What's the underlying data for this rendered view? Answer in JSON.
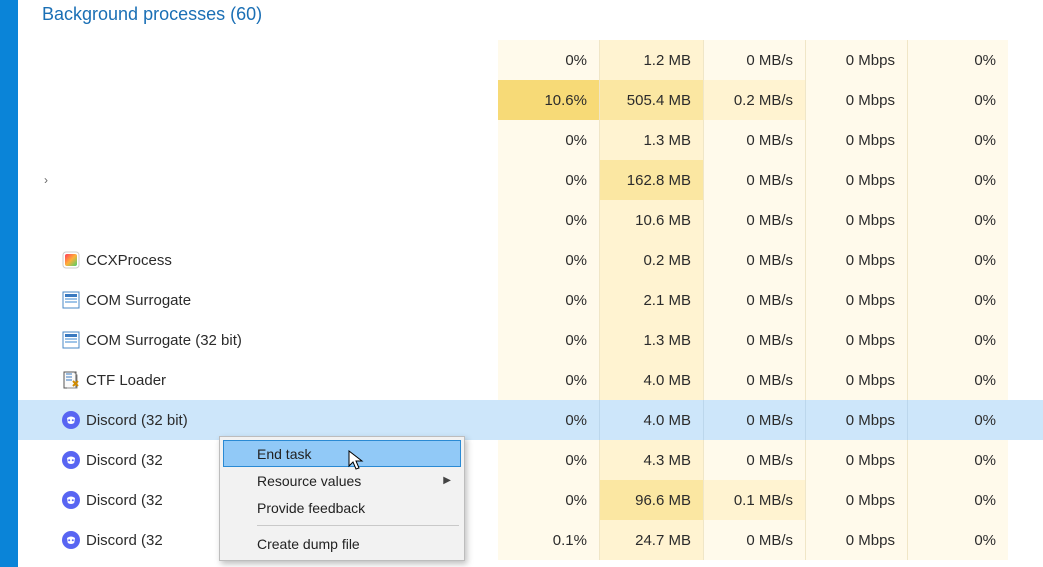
{
  "section_title": "Background processes (60)",
  "rows": [
    {
      "name": "",
      "icon": "",
      "caret": "",
      "cpu": "0%",
      "mem": "1.2 MB",
      "disk": "0 MB/s",
      "net": "0 Mbps",
      "gpu": "0%",
      "heat_cpu": "heat0",
      "heat_mem": "heat1",
      "heat_disk": "heat0",
      "heat_net": "heat0",
      "heat_gpu": "heat0",
      "selected": false
    },
    {
      "name": "",
      "icon": "",
      "caret": "",
      "cpu": "10.6%",
      "mem": "505.4 MB",
      "disk": "0.2 MB/s",
      "net": "0 Mbps",
      "gpu": "0%",
      "heat_cpu": "heat3",
      "heat_mem": "heat2",
      "heat_disk": "heat1",
      "heat_net": "heat0",
      "heat_gpu": "heat0",
      "selected": false
    },
    {
      "name": "",
      "icon": "",
      "caret": "",
      "cpu": "0%",
      "mem": "1.3 MB",
      "disk": "0 MB/s",
      "net": "0 Mbps",
      "gpu": "0%",
      "heat_cpu": "heat0",
      "heat_mem": "heat1",
      "heat_disk": "heat0",
      "heat_net": "heat0",
      "heat_gpu": "heat0",
      "selected": false
    },
    {
      "name": "",
      "icon": "",
      "caret": ">",
      "cpu": "0%",
      "mem": "162.8 MB",
      "disk": "0 MB/s",
      "net": "0 Mbps",
      "gpu": "0%",
      "heat_cpu": "heat0",
      "heat_mem": "heat2",
      "heat_disk": "heat0",
      "heat_net": "heat0",
      "heat_gpu": "heat0",
      "selected": false
    },
    {
      "name": "",
      "icon": "",
      "caret": "",
      "cpu": "0%",
      "mem": "10.6 MB",
      "disk": "0 MB/s",
      "net": "0 Mbps",
      "gpu": "0%",
      "heat_cpu": "heat0",
      "heat_mem": "heat1",
      "heat_disk": "heat0",
      "heat_net": "heat0",
      "heat_gpu": "heat0",
      "selected": false
    },
    {
      "name": "CCXProcess",
      "icon": "ccx",
      "caret": "",
      "cpu": "0%",
      "mem": "0.2 MB",
      "disk": "0 MB/s",
      "net": "0 Mbps",
      "gpu": "0%",
      "heat_cpu": "heat0",
      "heat_mem": "heat1",
      "heat_disk": "heat0",
      "heat_net": "heat0",
      "heat_gpu": "heat0",
      "selected": false
    },
    {
      "name": "COM Surrogate",
      "icon": "win",
      "caret": "",
      "cpu": "0%",
      "mem": "2.1 MB",
      "disk": "0 MB/s",
      "net": "0 Mbps",
      "gpu": "0%",
      "heat_cpu": "heat0",
      "heat_mem": "heat1",
      "heat_disk": "heat0",
      "heat_net": "heat0",
      "heat_gpu": "heat0",
      "selected": false
    },
    {
      "name": "COM Surrogate (32 bit)",
      "icon": "win",
      "caret": "",
      "cpu": "0%",
      "mem": "1.3 MB",
      "disk": "0 MB/s",
      "net": "0 Mbps",
      "gpu": "0%",
      "heat_cpu": "heat0",
      "heat_mem": "heat1",
      "heat_disk": "heat0",
      "heat_net": "heat0",
      "heat_gpu": "heat0",
      "selected": false
    },
    {
      "name": "CTF Loader",
      "icon": "ctf",
      "caret": "",
      "cpu": "0%",
      "mem": "4.0 MB",
      "disk": "0 MB/s",
      "net": "0 Mbps",
      "gpu": "0%",
      "heat_cpu": "heat0",
      "heat_mem": "heat1",
      "heat_disk": "heat0",
      "heat_net": "heat0",
      "heat_gpu": "heat0",
      "selected": false
    },
    {
      "name": "Discord (32 bit)",
      "icon": "discord",
      "caret": "",
      "cpu": "0%",
      "mem": "4.0 MB",
      "disk": "0 MB/s",
      "net": "0 Mbps",
      "gpu": "0%",
      "heat_cpu": "heat0",
      "heat_mem": "heat1",
      "heat_disk": "heat0",
      "heat_net": "heat0",
      "heat_gpu": "heat0",
      "selected": true
    },
    {
      "name": "Discord (32",
      "icon": "discord",
      "caret": "",
      "cpu": "0%",
      "mem": "4.3 MB",
      "disk": "0 MB/s",
      "net": "0 Mbps",
      "gpu": "0%",
      "heat_cpu": "heat0",
      "heat_mem": "heat1",
      "heat_disk": "heat0",
      "heat_net": "heat0",
      "heat_gpu": "heat0",
      "selected": false
    },
    {
      "name": "Discord (32",
      "icon": "discord",
      "caret": "",
      "cpu": "0%",
      "mem": "96.6 MB",
      "disk": "0.1 MB/s",
      "net": "0 Mbps",
      "gpu": "0%",
      "heat_cpu": "heat0",
      "heat_mem": "heat2",
      "heat_disk": "heat1",
      "heat_net": "heat0",
      "heat_gpu": "heat0",
      "selected": false
    },
    {
      "name": "Discord (32",
      "icon": "discord",
      "caret": "",
      "cpu": "0.1%",
      "mem": "24.7 MB",
      "disk": "0 MB/s",
      "net": "0 Mbps",
      "gpu": "0%",
      "heat_cpu": "heat0",
      "heat_mem": "heat1",
      "heat_disk": "heat0",
      "heat_net": "heat0",
      "heat_gpu": "heat0",
      "selected": false
    }
  ],
  "context_menu": {
    "end_task": "End task",
    "resource_values": "Resource values",
    "provide_feedback": "Provide feedback",
    "create_dump_file": "Create dump file"
  },
  "icons": {
    "ccx": "ccx-app-icon",
    "win": "windows-app-icon",
    "ctf": "ctf-loader-icon",
    "discord": "discord-icon"
  }
}
